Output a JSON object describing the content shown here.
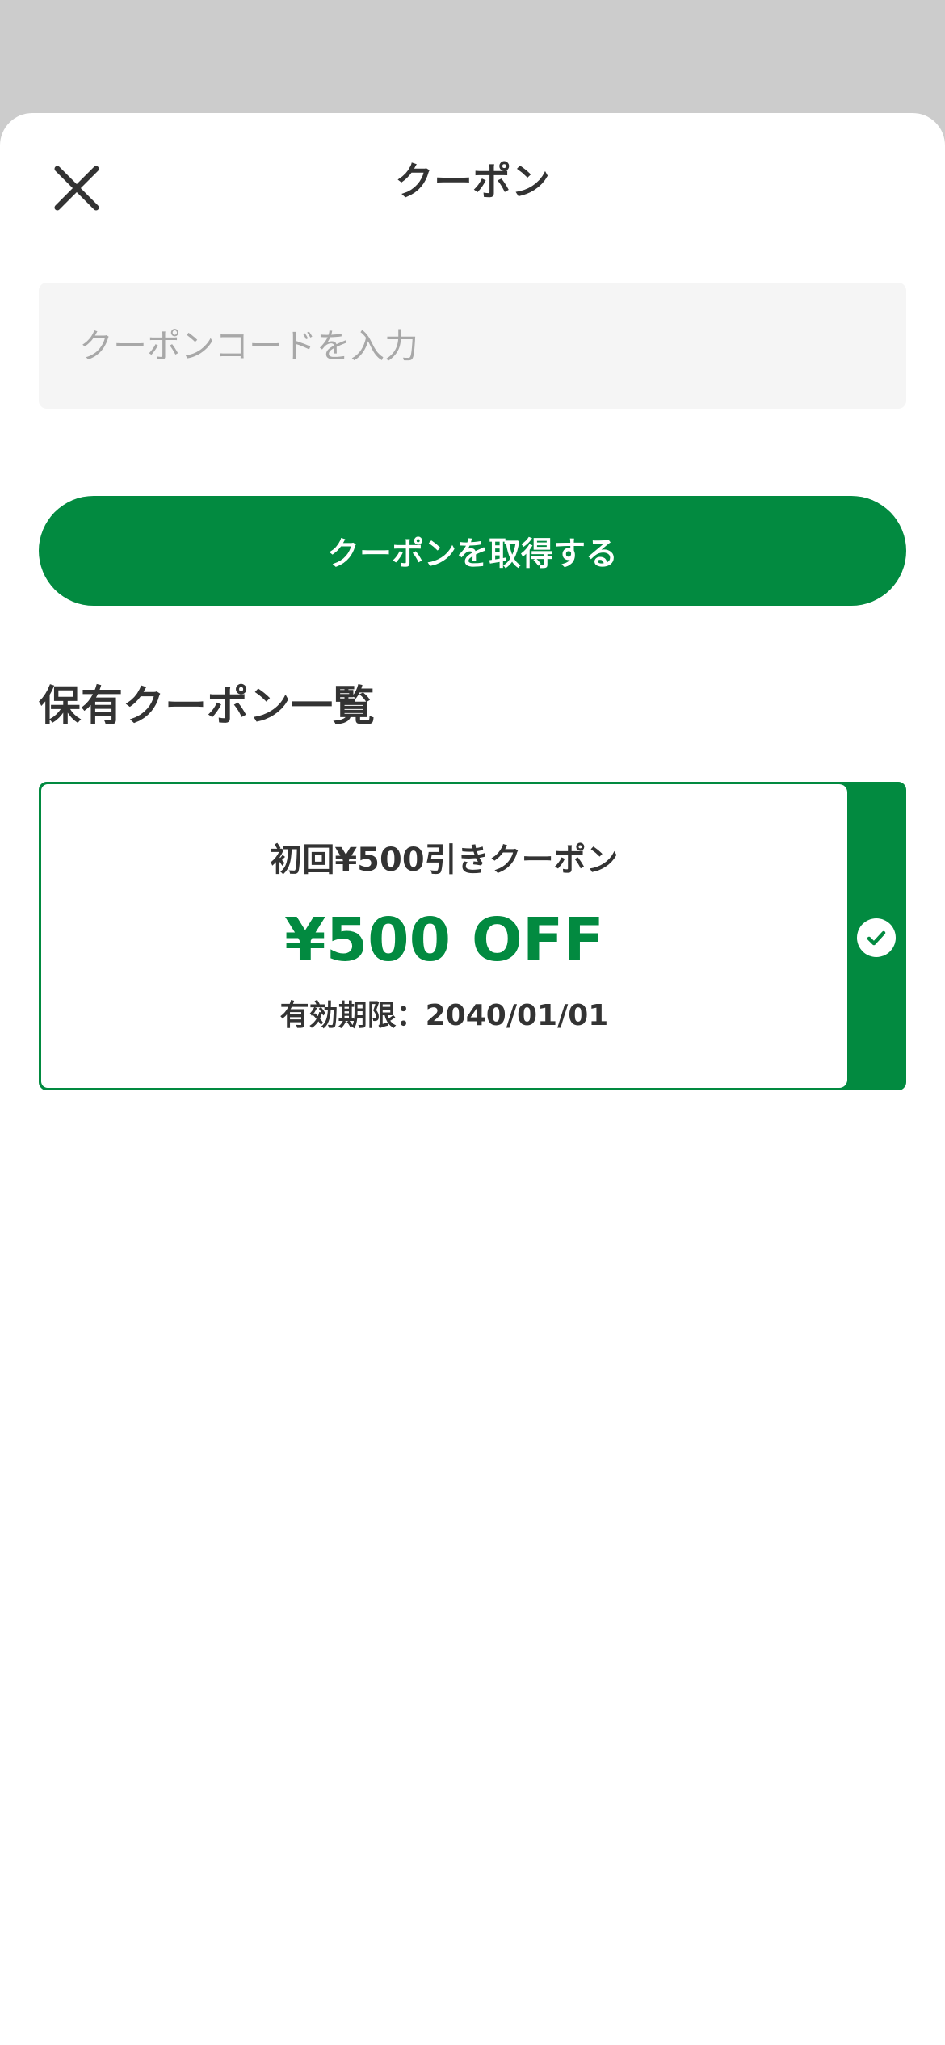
{
  "header": {
    "title": "クーポン",
    "close_icon": "close-icon"
  },
  "code_input": {
    "placeholder": "クーポンコードを入力",
    "value": ""
  },
  "get_button": {
    "label": "クーポンを取得する"
  },
  "owned_section": {
    "title": "保有クーポン一覧"
  },
  "coupons": [
    {
      "name": "初回¥500引きクーポン",
      "amount": "¥500 OFF",
      "expiry": "有効期限：2040/01/01",
      "selected": true,
      "status_icon": "check-circle-icon"
    }
  ],
  "colors": {
    "accent": "#028a40",
    "text": "#333333",
    "backdrop": "#cccccc",
    "input_bg": "#f5f5f5",
    "placeholder": "#a8a8a8"
  }
}
